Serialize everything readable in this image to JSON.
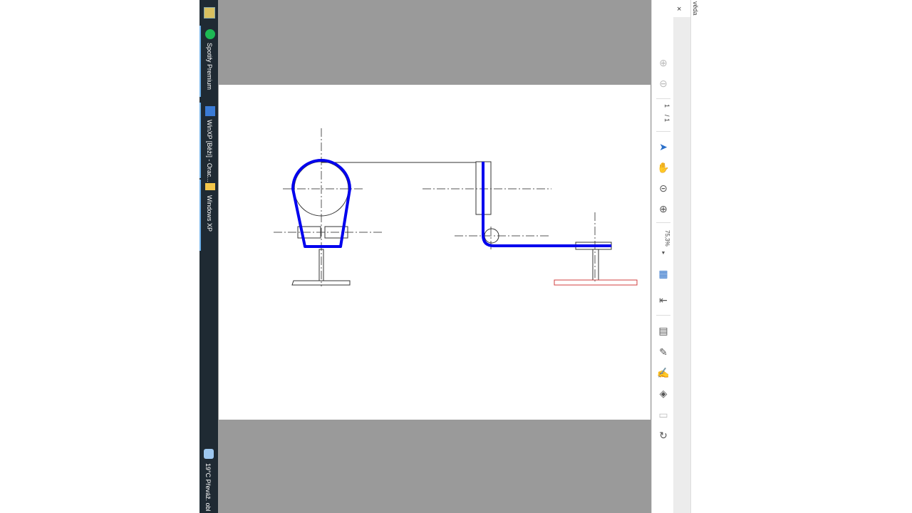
{
  "taskbar": {
    "items": [
      {
        "label": "",
        "icon": "control-panel-icon"
      },
      {
        "label": "Spotify Premium",
        "icon": "spotify-icon"
      },
      {
        "label": "WinXP [Běží] - Orac...",
        "icon": "virtualbox-icon"
      },
      {
        "label": "Windows XP",
        "icon": "folder-icon"
      }
    ],
    "weather": {
      "label": "19°C  Převáž. obl",
      "icon": "weather-icon"
    }
  },
  "viewer": {
    "page_indicator": {
      "current": "1",
      "total": "/ 1"
    },
    "zoom": "75,3%",
    "close": "×",
    "side_label": "věda",
    "colors": {
      "belt": "#0000ee",
      "highlight": "#d04040",
      "line": "#333333"
    }
  },
  "tools": [
    "next-page-icon",
    "previous-page-icon",
    "select-icon",
    "hand-icon",
    "zoom-out-icon",
    "zoom-in-icon",
    "fit-page-icon",
    "export-icon",
    "comment-icon",
    "pencil-icon",
    "sign-icon",
    "stamp-icon",
    "form-icon",
    "rotate-icon"
  ]
}
